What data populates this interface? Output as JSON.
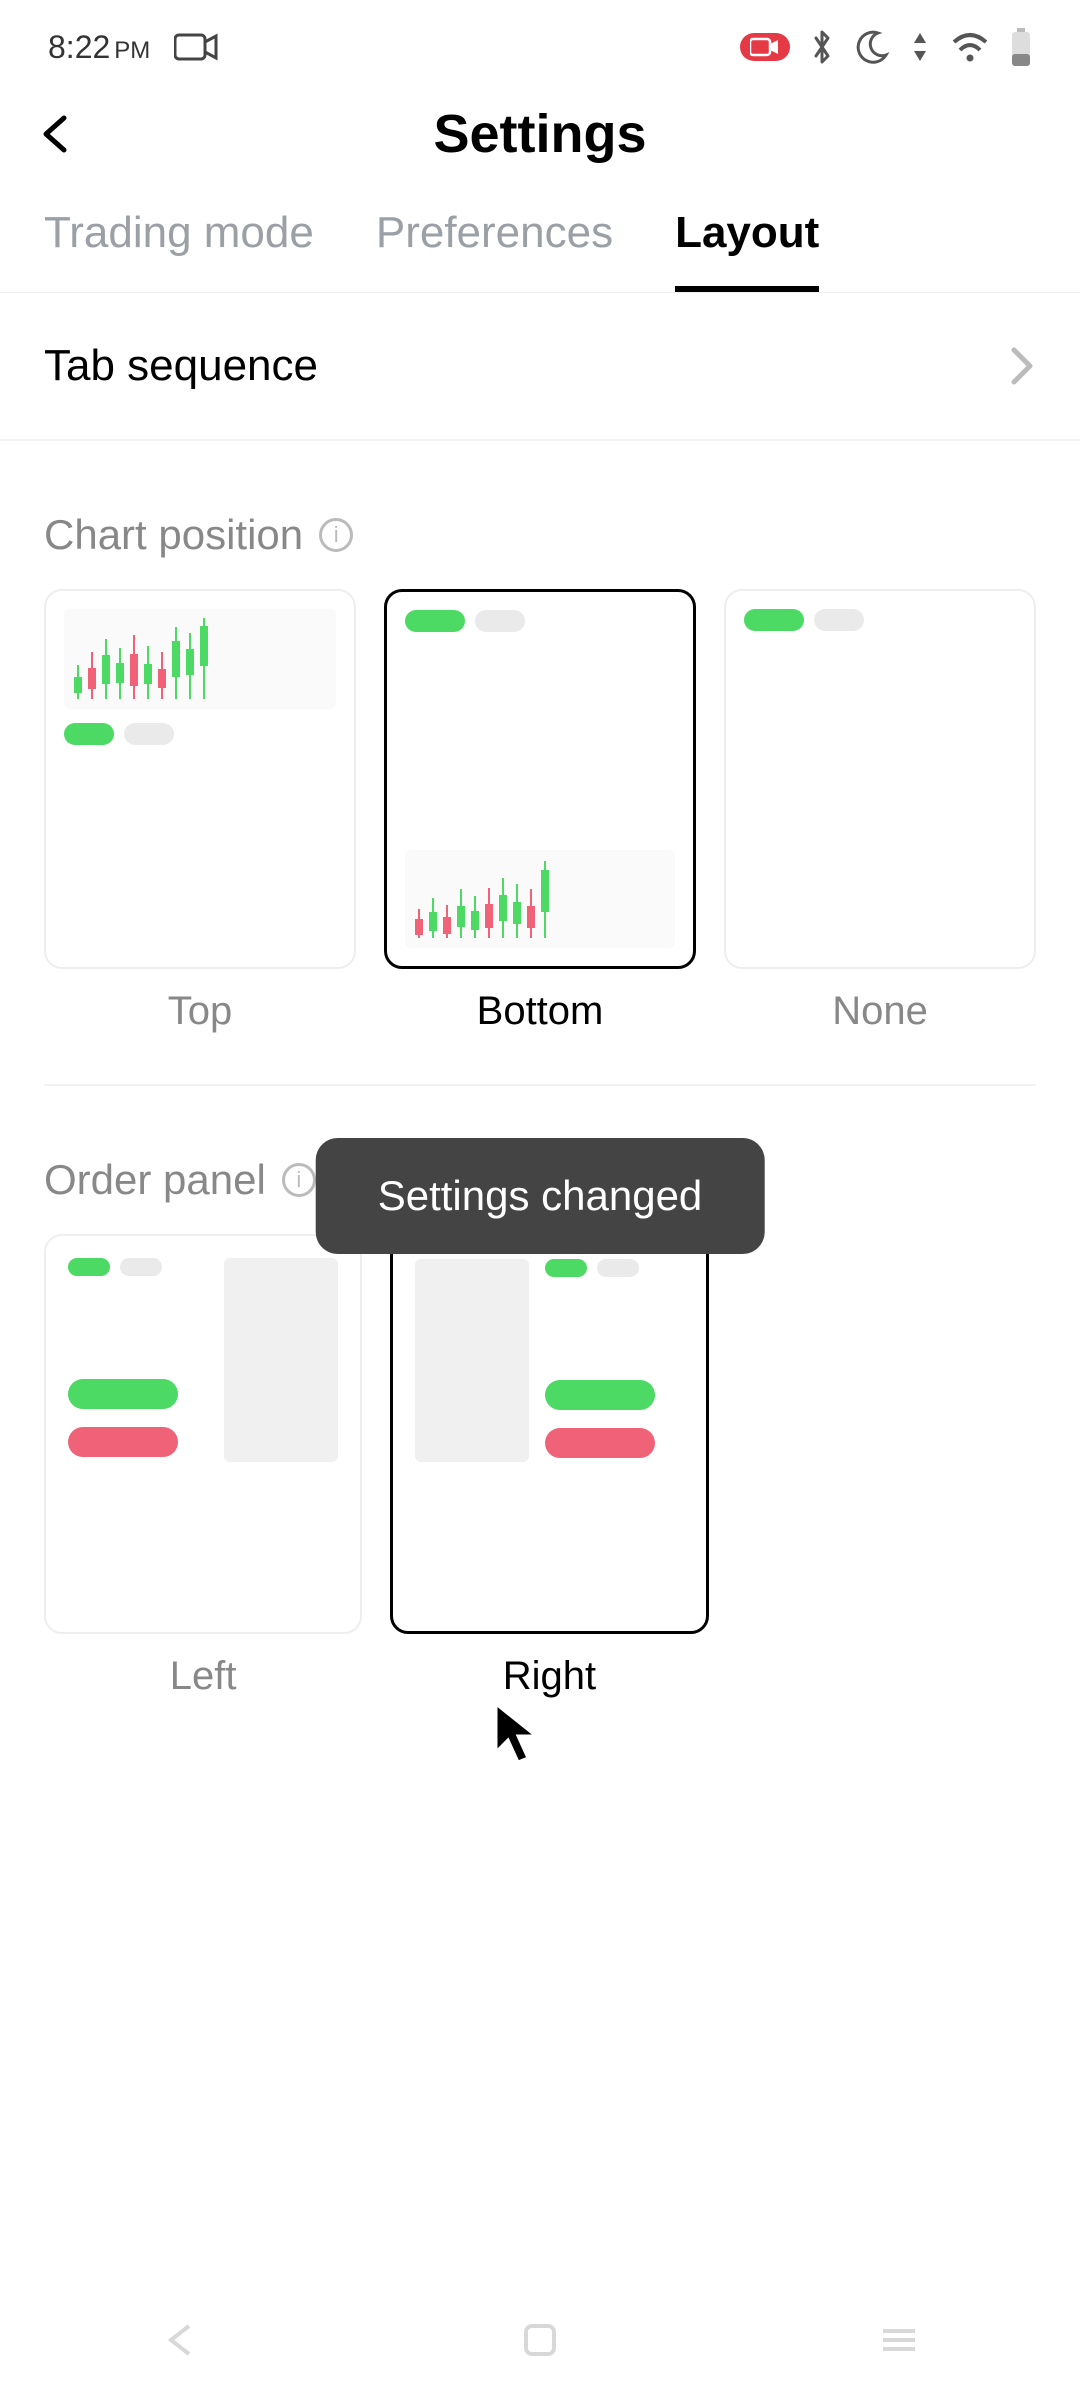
{
  "status_bar": {
    "time": "8:22",
    "period": "PM"
  },
  "header": {
    "title": "Settings"
  },
  "tabs": {
    "items": [
      "Trading mode",
      "Preferences",
      "Layout"
    ],
    "active_index": 2
  },
  "rows": {
    "tab_sequence": "Tab sequence"
  },
  "sections": {
    "chart_position": {
      "title": "Chart position",
      "options": [
        "Top",
        "Bottom",
        "None"
      ],
      "selected_index": 1
    },
    "order_panel": {
      "title": "Order panel",
      "options": [
        "Left",
        "Right"
      ],
      "selected_index": 1
    }
  },
  "toast": {
    "message": "Settings changed"
  }
}
